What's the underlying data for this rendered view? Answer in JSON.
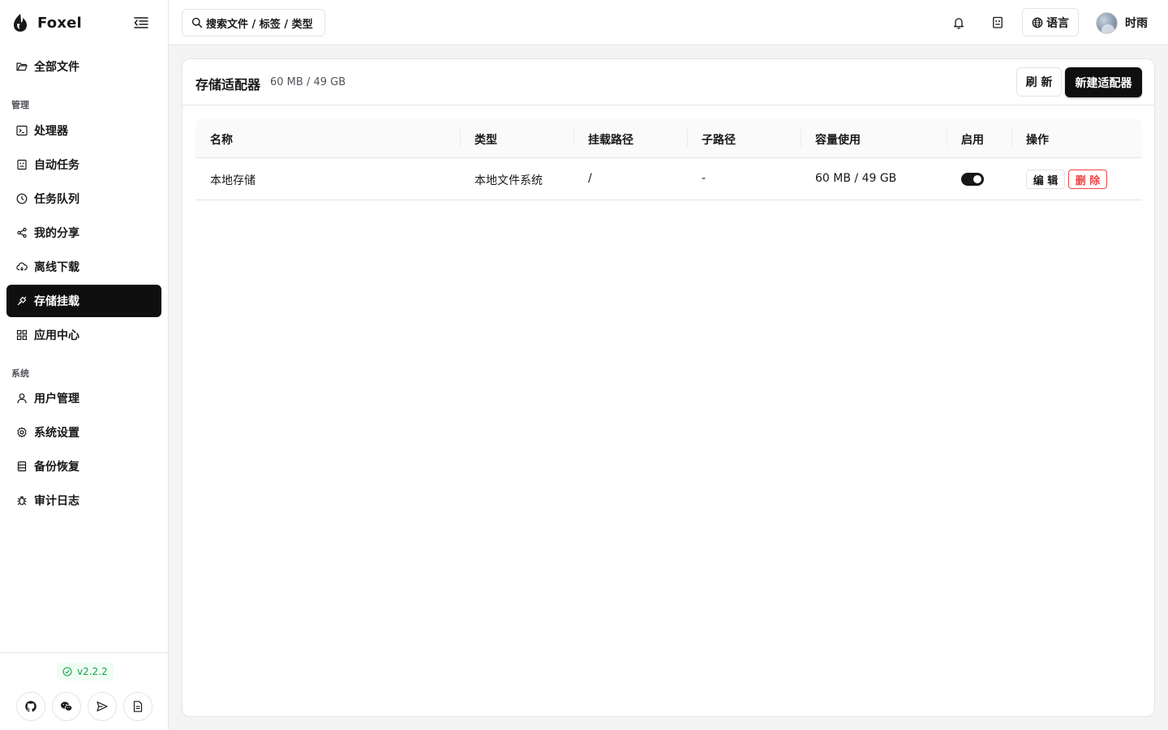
{
  "app": {
    "name": "Foxel",
    "version": "v2.2.2"
  },
  "sidebar": {
    "top_item": {
      "label": "全部文件",
      "icon": "folder-open-icon"
    },
    "sections": [
      {
        "title": "管理",
        "items": [
          {
            "label": "处理器",
            "icon": "terminal-icon"
          },
          {
            "label": "自动任务",
            "icon": "robot-icon"
          },
          {
            "label": "任务队列",
            "icon": "clock-icon"
          },
          {
            "label": "我的分享",
            "icon": "share-icon"
          },
          {
            "label": "离线下载",
            "icon": "cloud-download-icon"
          },
          {
            "label": "存储挂载",
            "icon": "plug-icon",
            "active": true
          },
          {
            "label": "应用中心",
            "icon": "grid-icon"
          }
        ]
      },
      {
        "title": "系统",
        "items": [
          {
            "label": "用户管理",
            "icon": "user-icon"
          },
          {
            "label": "系统设置",
            "icon": "gear-icon"
          },
          {
            "label": "备份恢复",
            "icon": "database-icon"
          },
          {
            "label": "审计日志",
            "icon": "bug-icon"
          }
        ]
      }
    ],
    "footer_links": [
      "github-icon",
      "wechat-icon",
      "send-icon",
      "document-icon"
    ]
  },
  "header": {
    "search_placeholder": "搜索文件 / 标签 / 类型",
    "language_label": "语言",
    "user_name": "时雨"
  },
  "page": {
    "title": "存储适配器",
    "usage_summary": "60 MB / 49 GB",
    "refresh_label": "刷 新",
    "new_label": "新建适配器"
  },
  "table": {
    "columns": [
      "名称",
      "类型",
      "挂载路径",
      "子路径",
      "容量使用",
      "启用",
      "操作"
    ],
    "rows": [
      {
        "name": "本地存储",
        "type": "本地文件系统",
        "mount_path": "/",
        "sub_path": "-",
        "capacity": "60 MB / 49 GB",
        "enabled": true,
        "edit_label": "编 辑",
        "delete_label": "删 除"
      }
    ]
  },
  "colors": {
    "primary": "#0f0f10",
    "danger": "#ef4444",
    "success": "#16a34a",
    "border": "#e4e4e7",
    "background": "#f4f4f5"
  }
}
